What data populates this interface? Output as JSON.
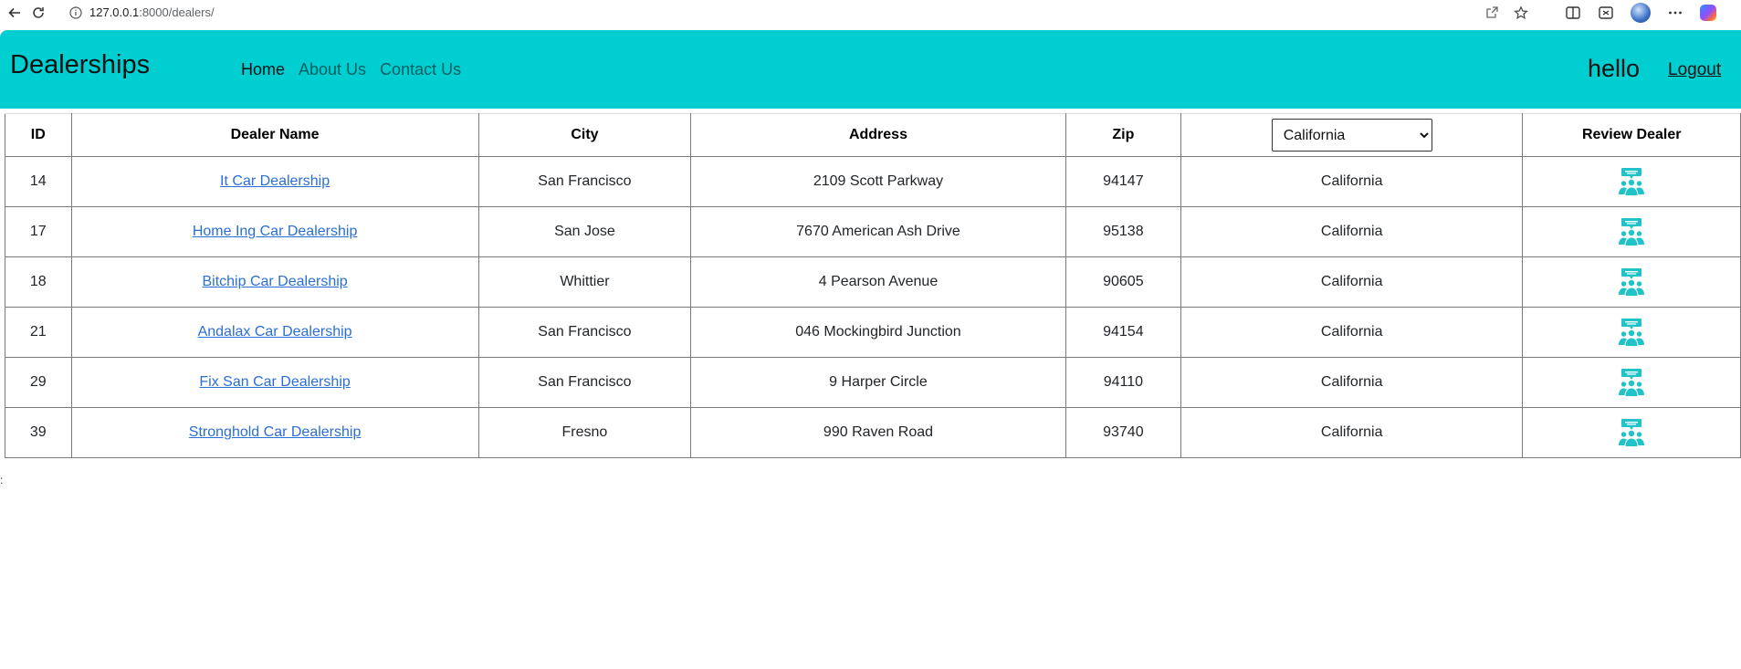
{
  "browser": {
    "url_host": "127.0.0.1",
    "url_path": ":8000/dealers/"
  },
  "navbar": {
    "brand": "Dealerships",
    "links": [
      {
        "label": "Home",
        "active": true
      },
      {
        "label": "About Us",
        "active": false
      },
      {
        "label": "Contact Us",
        "active": false
      }
    ],
    "greeting": "hello",
    "logout_label": "Logout"
  },
  "table": {
    "headers": {
      "id": "ID",
      "dealer_name": "Dealer Name",
      "city": "City",
      "address": "Address",
      "zip": "Zip",
      "review": "Review Dealer"
    },
    "state_filter": {
      "selected": "California"
    },
    "rows": [
      {
        "id": "14",
        "name": "It Car Dealership",
        "city": "San Francisco",
        "address": "2109 Scott Parkway",
        "zip": "94147",
        "state": "California"
      },
      {
        "id": "17",
        "name": "Home Ing Car Dealership",
        "city": "San Jose",
        "address": "7670 American Ash Drive",
        "zip": "95138",
        "state": "California"
      },
      {
        "id": "18",
        "name": "Bitchip Car Dealership",
        "city": "Whittier",
        "address": "4 Pearson Avenue",
        "zip": "90605",
        "state": "California"
      },
      {
        "id": "21",
        "name": "Andalax Car Dealership",
        "city": "San Francisco",
        "address": "046 Mockingbird Junction",
        "zip": "94154",
        "state": "California"
      },
      {
        "id": "29",
        "name": "Fix San Car Dealership",
        "city": "San Francisco",
        "address": "9 Harper Circle",
        "zip": "94110",
        "state": "California"
      },
      {
        "id": "39",
        "name": "Stronghold Car Dealership",
        "city": "Fresno",
        "address": "990 Raven Road",
        "zip": "93740",
        "state": "California"
      }
    ]
  },
  "colors": {
    "navbar_bg": "#00ced1",
    "link": "#2a6fd6",
    "review_icon": "#20c3c8"
  },
  "stray_text": ":"
}
